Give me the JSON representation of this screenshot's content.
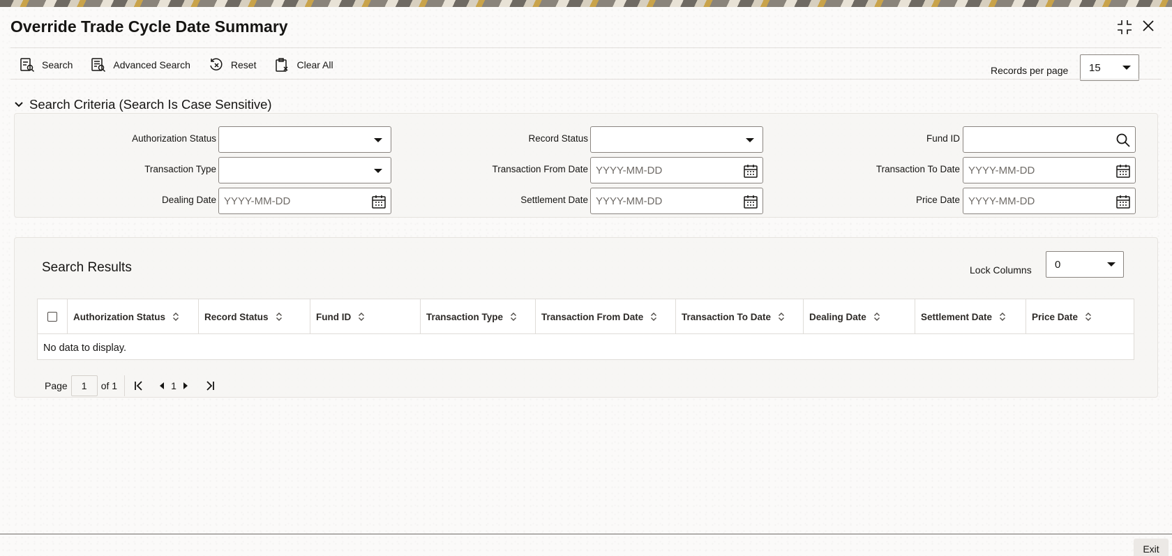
{
  "window": {
    "title": "Override Trade Cycle Date Summary"
  },
  "toolbar": {
    "search": "Search",
    "advanced_search": "Advanced Search",
    "reset": "Reset",
    "clear_all": "Clear All"
  },
  "records_per_page": {
    "label": "Records per page",
    "value": "15"
  },
  "criteria": {
    "heading": "Search Criteria (Search Is Case Sensitive)",
    "date_placeholder": "YYYY-MM-DD",
    "fields": {
      "authorization_status": "Authorization Status",
      "record_status": "Record Status",
      "fund_id": "Fund ID",
      "transaction_type": "Transaction Type",
      "transaction_from_date": "Transaction From Date",
      "transaction_to_date": "Transaction To Date",
      "dealing_date": "Dealing Date",
      "settlement_date": "Settlement Date",
      "price_date": "Price Date"
    }
  },
  "results": {
    "heading": "Search Results",
    "lock_columns_label": "Lock Columns",
    "lock_columns_value": "0",
    "columns": [
      "Authorization Status",
      "Record Status",
      "Fund ID",
      "Transaction Type",
      "Transaction From Date",
      "Transaction To Date",
      "Dealing Date",
      "Settlement Date",
      "Price Date"
    ],
    "empty_message": "No data to display."
  },
  "pagination": {
    "page_label": "Page",
    "current_page": "1",
    "of_label": "of 1",
    "page_number": "1"
  },
  "footer": {
    "exit": "Exit"
  }
}
